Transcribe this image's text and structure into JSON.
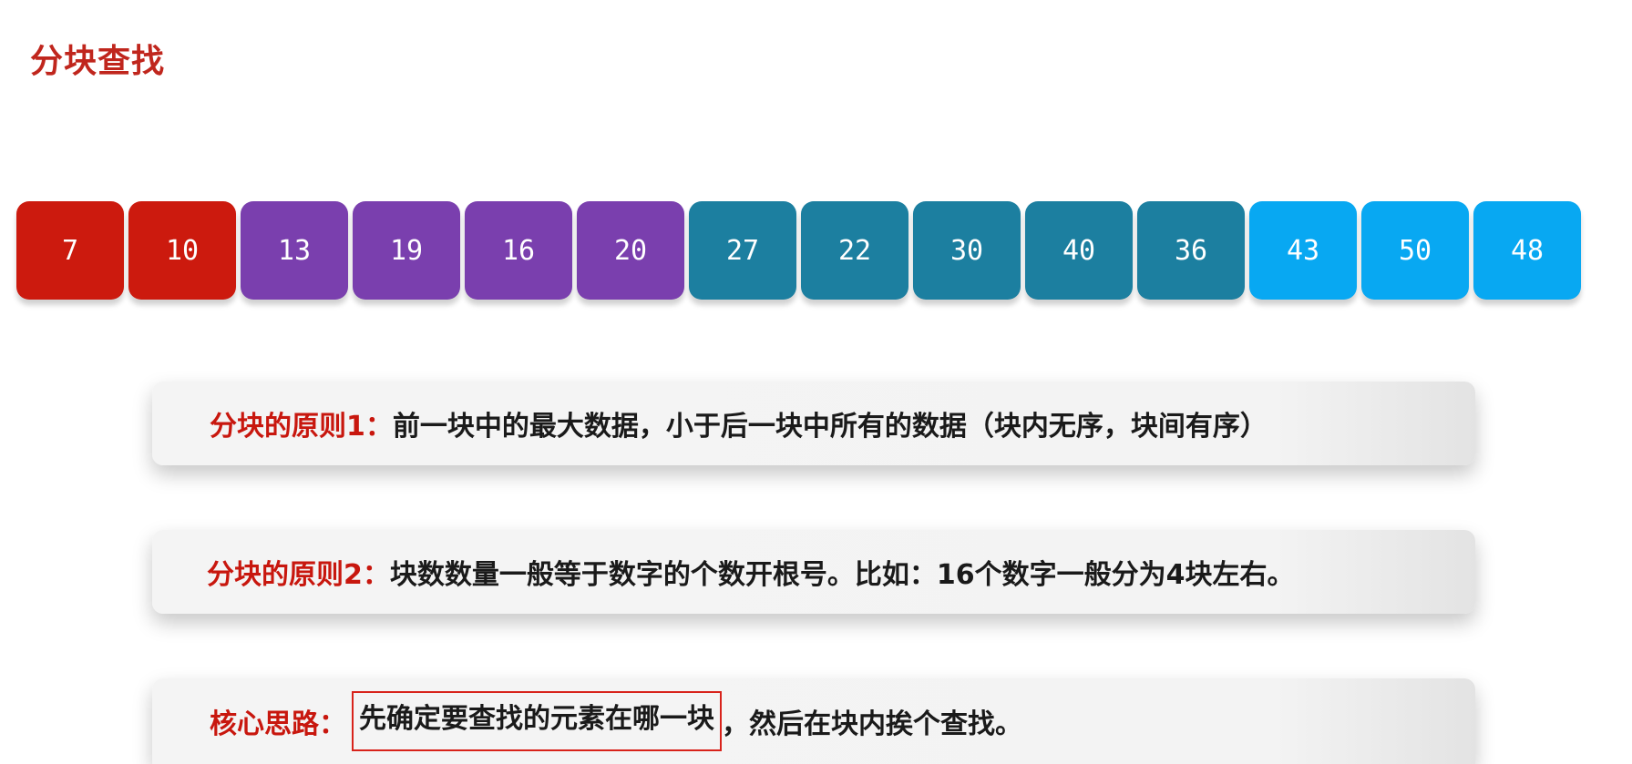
{
  "title": "分块查找",
  "blocks": [
    {
      "value": "7",
      "color": "#cc1a0e"
    },
    {
      "value": "10",
      "color": "#cc1a0e"
    },
    {
      "value": "13",
      "color": "#7a3fae"
    },
    {
      "value": "19",
      "color": "#7a3fae"
    },
    {
      "value": "16",
      "color": "#7a3fae"
    },
    {
      "value": "20",
      "color": "#7a3fae"
    },
    {
      "value": "27",
      "color": "#1c7fa0"
    },
    {
      "value": "22",
      "color": "#1c7fa0"
    },
    {
      "value": "30",
      "color": "#1c7fa0"
    },
    {
      "value": "40",
      "color": "#1c7fa0"
    },
    {
      "value": "36",
      "color": "#1c7fa0"
    },
    {
      "value": "43",
      "color": "#08a8f2"
    },
    {
      "value": "50",
      "color": "#08a8f2"
    },
    {
      "value": "48",
      "color": "#08a8f2"
    }
  ],
  "principle1": {
    "label": "分块的原则1：",
    "text": "前一块中的最大数据，小于后一块中所有的数据（块内无序，块间有序）"
  },
  "principle2": {
    "label": "分块的原则2：",
    "text": "块数数量一般等于数字的个数开根号。比如：16个数字一般分为4块左右。"
  },
  "core": {
    "label": "核心思路：",
    "highlight": "先确定要查找的元素在哪一块",
    "text": "，然后在块内挨个查找。"
  },
  "colors": {
    "title": "#c0261d",
    "label": "#c8170e",
    "highlight_border": "#d8231b"
  }
}
